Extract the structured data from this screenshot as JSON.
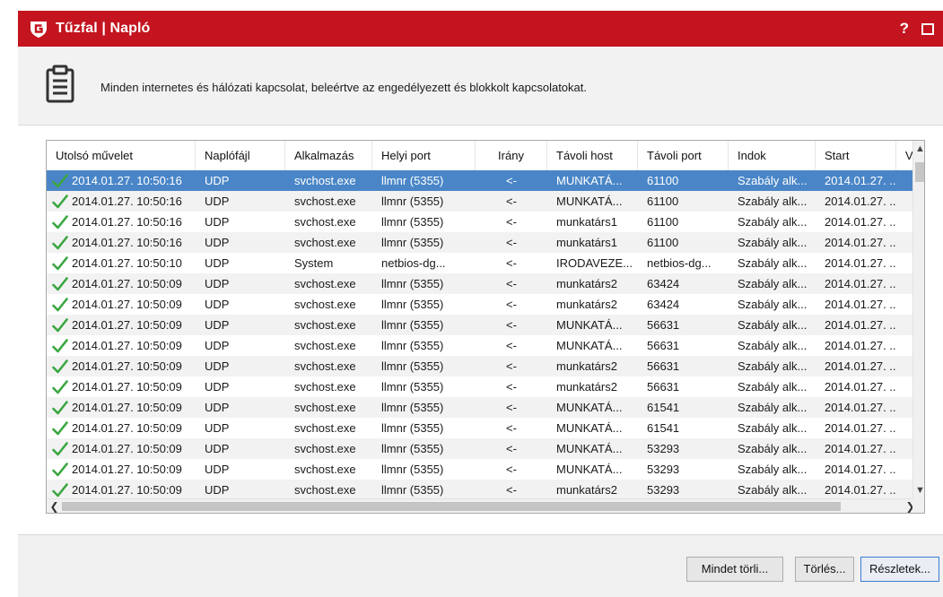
{
  "window": {
    "title": "Tűzfal | Napló",
    "help_label": "?"
  },
  "header": {
    "description": "Minden internetes és hálózati kapcsolat, beleértve az engedélyezett és blokkolt kapcsolatokat."
  },
  "table": {
    "columns": [
      "Utolsó művelet",
      "Naplófájl",
      "Alkalmazás",
      "Helyi port",
      "Irány",
      "Távoli host",
      "Távoli port",
      "Indok",
      "Start",
      "Ve"
    ],
    "rows": [
      [
        "2014.01.27. 10:50:16",
        "UDP",
        "svchost.exe",
        "llmnr (5355)",
        "<-",
        "MUNKATÁ...",
        "61100",
        "Szabály alk...",
        "2014.01.27. ..."
      ],
      [
        "2014.01.27. 10:50:16",
        "UDP",
        "svchost.exe",
        "llmnr (5355)",
        "<-",
        "MUNKATÁ...",
        "61100",
        "Szabály alk...",
        "2014.01.27. ..."
      ],
      [
        "2014.01.27. 10:50:16",
        "UDP",
        "svchost.exe",
        "llmnr (5355)",
        "<-",
        "munkatárs1",
        "61100",
        "Szabály alk...",
        "2014.01.27. ..."
      ],
      [
        "2014.01.27. 10:50:16",
        "UDP",
        "svchost.exe",
        "llmnr (5355)",
        "<-",
        "munkatárs1",
        "61100",
        "Szabály alk...",
        "2014.01.27. ..."
      ],
      [
        "2014.01.27. 10:50:10",
        "UDP",
        "System",
        "netbios-dg...",
        "<-",
        "IRODAVEZE...",
        "netbios-dg...",
        "Szabály alk...",
        "2014.01.27. ..."
      ],
      [
        "2014.01.27. 10:50:09",
        "UDP",
        "svchost.exe",
        "llmnr (5355)",
        "<-",
        "munkatárs2",
        "63424",
        "Szabály alk...",
        "2014.01.27. ..."
      ],
      [
        "2014.01.27. 10:50:09",
        "UDP",
        "svchost.exe",
        "llmnr (5355)",
        "<-",
        "munkatárs2",
        "63424",
        "Szabály alk...",
        "2014.01.27. ..."
      ],
      [
        "2014.01.27. 10:50:09",
        "UDP",
        "svchost.exe",
        "llmnr (5355)",
        "<-",
        "MUNKATÁ...",
        "56631",
        "Szabály alk...",
        "2014.01.27. ..."
      ],
      [
        "2014.01.27. 10:50:09",
        "UDP",
        "svchost.exe",
        "llmnr (5355)",
        "<-",
        "MUNKATÁ...",
        "56631",
        "Szabály alk...",
        "2014.01.27. ..."
      ],
      [
        "2014.01.27. 10:50:09",
        "UDP",
        "svchost.exe",
        "llmnr (5355)",
        "<-",
        "munkatárs2",
        "56631",
        "Szabály alk...",
        "2014.01.27. ..."
      ],
      [
        "2014.01.27. 10:50:09",
        "UDP",
        "svchost.exe",
        "llmnr (5355)",
        "<-",
        "munkatárs2",
        "56631",
        "Szabály alk...",
        "2014.01.27. ..."
      ],
      [
        "2014.01.27. 10:50:09",
        "UDP",
        "svchost.exe",
        "llmnr (5355)",
        "<-",
        "MUNKATÁ...",
        "61541",
        "Szabály alk...",
        "2014.01.27. ..."
      ],
      [
        "2014.01.27. 10:50:09",
        "UDP",
        "svchost.exe",
        "llmnr (5355)",
        "<-",
        "MUNKATÁ...",
        "61541",
        "Szabály alk...",
        "2014.01.27. ..."
      ],
      [
        "2014.01.27. 10:50:09",
        "UDP",
        "svchost.exe",
        "llmnr (5355)",
        "<-",
        "MUNKATÁ...",
        "53293",
        "Szabály alk...",
        "2014.01.27. ..."
      ],
      [
        "2014.01.27. 10:50:09",
        "UDP",
        "svchost.exe",
        "llmnr (5355)",
        "<-",
        "MUNKATÁ...",
        "53293",
        "Szabály alk...",
        "2014.01.27. ..."
      ],
      [
        "2014.01.27. 10:50:09",
        "UDP",
        "svchost.exe",
        "llmnr (5355)",
        "<-",
        "munkatárs2",
        "53293",
        "Szabály alk...",
        "2014.01.27. ..."
      ]
    ],
    "selected_row": 0,
    "status_icon": "check-icon"
  },
  "buttons": {
    "clear_all": "Mindet törli...",
    "delete": "Törlés...",
    "details": "Részletek..."
  },
  "colors": {
    "titlebar": "#c3141f",
    "selection": "#4a86c7",
    "check": "#3aa640"
  }
}
